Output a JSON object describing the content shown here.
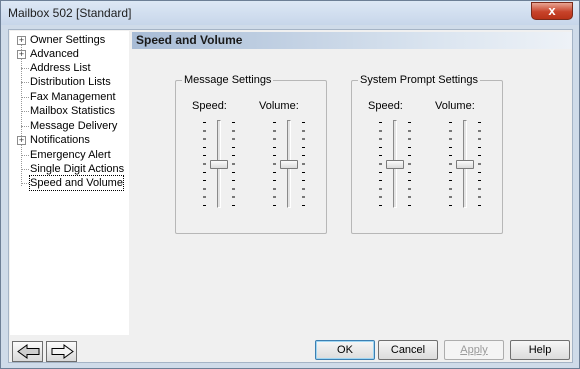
{
  "window": {
    "title": "Mailbox 502 [Standard]",
    "close_glyph": "x"
  },
  "tree": {
    "items": [
      {
        "label": "Owner Settings",
        "expandable": true
      },
      {
        "label": "Advanced",
        "expandable": true
      },
      {
        "label": "Address List",
        "expandable": false
      },
      {
        "label": "Distribution Lists",
        "expandable": false
      },
      {
        "label": "Fax Management",
        "expandable": false
      },
      {
        "label": "Mailbox Statistics",
        "expandable": false
      },
      {
        "label": "Message Delivery",
        "expandable": false
      },
      {
        "label": "Notifications",
        "expandable": true
      },
      {
        "label": "Emergency Alert",
        "expandable": false
      },
      {
        "label": "Single Digit Actions",
        "expandable": false
      },
      {
        "label": "Speed and Volume",
        "expandable": false,
        "selected": true
      }
    ]
  },
  "main": {
    "header": "Speed and Volume",
    "message_settings": {
      "legend": "Message Settings",
      "speed_label": "Speed:",
      "volume_label": "Volume:",
      "speed_level": 0.5,
      "volume_level": 0.5
    },
    "system_prompt_settings": {
      "legend": "System Prompt Settings",
      "speed_label": "Speed:",
      "volume_label": "Volume:",
      "speed_level": 0.5,
      "volume_level": 0.5
    }
  },
  "buttons": {
    "ok": "OK",
    "cancel": "Cancel",
    "apply": "Apply",
    "help": "Help"
  },
  "icons": {
    "back": "arrow-left-icon",
    "forward": "arrow-right-icon"
  }
}
